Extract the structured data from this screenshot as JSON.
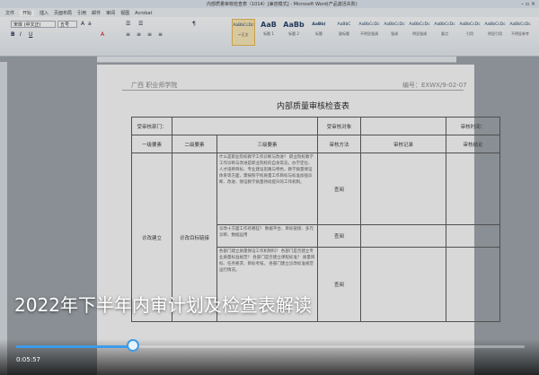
{
  "window": {
    "title": "内部质量审核检查表（1014）[兼容模式] - Microsoft Word(产品激活失败)",
    "controls": "– ▫ ×"
  },
  "ribbon": {
    "tabs": [
      "文件",
      "开始",
      "插入",
      "页面布局",
      "引用",
      "邮件",
      "审阅",
      "视图",
      "Acrobat"
    ],
    "active_tab": "开始",
    "font_name": "宋体 (中文正)",
    "font_size": "五号",
    "styles": [
      {
        "preview": "AaBbCcDc",
        "name": "↵正文"
      },
      {
        "preview": "AaB",
        "name": "标题 1"
      },
      {
        "preview": "AaBb",
        "name": "标题 2"
      },
      {
        "preview": "AaBb(",
        "name": "标题"
      },
      {
        "preview": "AaBbC",
        "name": "副标题"
      },
      {
        "preview": "AaBbCcDc",
        "name": "不明显强调"
      },
      {
        "preview": "AaBbCcDc",
        "name": "强调"
      },
      {
        "preview": "AaBbCcDc",
        "name": "明显强调"
      },
      {
        "preview": "AaBbCcDc",
        "name": "要点"
      },
      {
        "preview": "AaBbCcDc",
        "name": "引用"
      },
      {
        "preview": "AaBbCcDc",
        "name": "明显引用"
      },
      {
        "preview": "AaBbCcDc",
        "name": "不明显参考"
      }
    ]
  },
  "document": {
    "header_left": "广西    职业师学院",
    "header_right": "编号：EXWX/9-02-07",
    "title": "内部质量审核检查表",
    "table": {
      "row1": {
        "dept_label": "受审核部门：",
        "dept_value": "",
        "object_label": "受审核对象",
        "object_value": "",
        "date_label": "审核时间："
      },
      "headers": [
        "一级要素",
        "二级要素",
        "三级要素",
        "审核方法",
        "审核记录",
        "审核结论"
      ],
      "rows": [
        {
          "level1": "诊改建立",
          "level2": "诊改目标链接",
          "level3": "什么是职业院校教学工作诊断与改进？\n职业院校教学工作诊断与改进是职业院校的自身常态，办学定位、人才培养目标、专业建设思路与特色，教学质量保证体系等方面，需按照学校质量工作目标与标准加强诊断、改进、保证教学质量持续提升的工作机制。",
          "method": "查阅",
          "record": "",
          "conclusion": ""
        },
        {
          "level1": "",
          "level2": "",
          "level3": "诊改十方面工作有哪些？\n数据平台、目标链接、多元诊断、数据运用",
          "method": "查阅",
          "record": "",
          "conclusion": ""
        },
        {
          "level1": "",
          "level2": "",
          "level3": "各部门建立质量保证工作机制吗？\n各部门是否建立专业质量标准规范？\n各部门是否建立课程标准？\n质量目标、任务要求、目标考核。\n各部门建立诊改标准规范运行情况。",
          "method": "查阅",
          "record": "",
          "conclusion": ""
        }
      ]
    }
  },
  "video": {
    "caption": "2022年下半年内审计划及检查表解读",
    "current_time": "0:05:57",
    "progress_fraction": 0.23
  }
}
